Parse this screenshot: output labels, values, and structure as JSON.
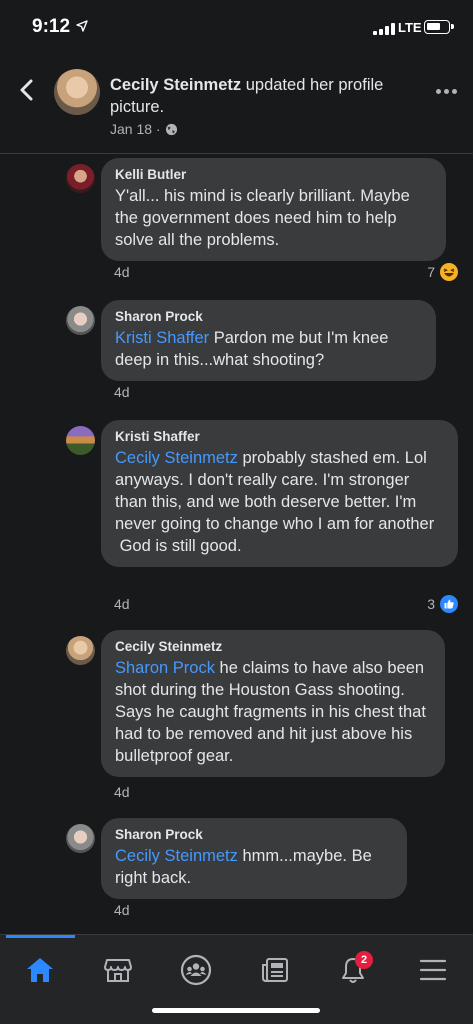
{
  "status_bar": {
    "time": "9:12",
    "network": "LTE"
  },
  "header": {
    "name": "Cecily Steinmetz",
    "action": " updated her profile picture.",
    "date": "Jan 18 ·",
    "privacy_icon": "globe-icon"
  },
  "comments": [
    {
      "name": "Kelli Butler",
      "mention": "",
      "text": "Y'all... his mind is clearly brilliant. Maybe the government does need him to help solve all the problems.",
      "time": "4d",
      "reaction_count": "7",
      "reaction_type": "haha"
    },
    {
      "name": "Sharon Prock",
      "mention": "Kristi Shaffer",
      "text": " Pardon me but I'm knee deep in this...what shooting?",
      "time": "4d"
    },
    {
      "name": "Kristi Shaffer",
      "mention": "Cecily Steinmetz",
      "text": " probably stashed em. Lol anyways. I don't really care. I'm stronger than this, and we both deserve better. I'm never going to change who I am for another\n God is still good.",
      "time": "4d",
      "reaction_count": "3",
      "reaction_type": "like"
    },
    {
      "name": "Cecily Steinmetz",
      "mention": "Sharon Prock",
      "text": " he claims to have also been shot during the Houston Gass shooting. Says he caught fragments in his chest that had to be removed and hit just above his bulletproof gear.",
      "time": "4d"
    },
    {
      "name": "Sharon Prock",
      "mention": "Cecily Steinmetz",
      "text": " hmm...maybe. Be right back.",
      "time": "4d"
    }
  ],
  "bottom_nav": {
    "items": [
      "home-icon",
      "marketplace-icon",
      "groups-icon",
      "news-icon",
      "notifications-icon",
      "menu-icon"
    ],
    "active": "home-icon",
    "notification_badge": "2"
  },
  "colors": {
    "background": "#18191a",
    "bubble": "#3a3b3c",
    "mention": "#4599ff",
    "accent": "#2d88ff"
  }
}
